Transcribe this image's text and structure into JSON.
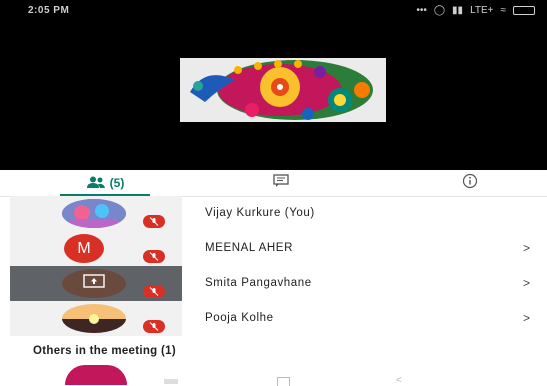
{
  "status": {
    "time": "2:05 PM",
    "network": "LTE+"
  },
  "tabs": [
    {
      "label": "(5)",
      "icon": "people-icon",
      "active": true
    },
    {
      "icon": "chat-icon"
    },
    {
      "icon": "info-icon"
    }
  ],
  "participants": [
    {
      "name": "Vijay Kurkure (You)",
      "avatar": "photo",
      "muted": true,
      "chevron": ""
    },
    {
      "name": "MEENAL AHER",
      "avatar": "M",
      "avatar_color": "#d93025",
      "muted": true,
      "chevron": ">"
    },
    {
      "name": "Smita Pangavhane",
      "avatar": "presenting-screen",
      "muted": true,
      "chevron": ">",
      "active": true
    },
    {
      "name": "Pooja Kolhe",
      "avatar": "photo",
      "muted": true,
      "chevron": ">"
    }
  ],
  "others_heading": "Others in the meeting (1)",
  "colors": {
    "accent": "#0a7d6a",
    "muted_badge": "#d93025",
    "active_row": "#5f6368"
  }
}
